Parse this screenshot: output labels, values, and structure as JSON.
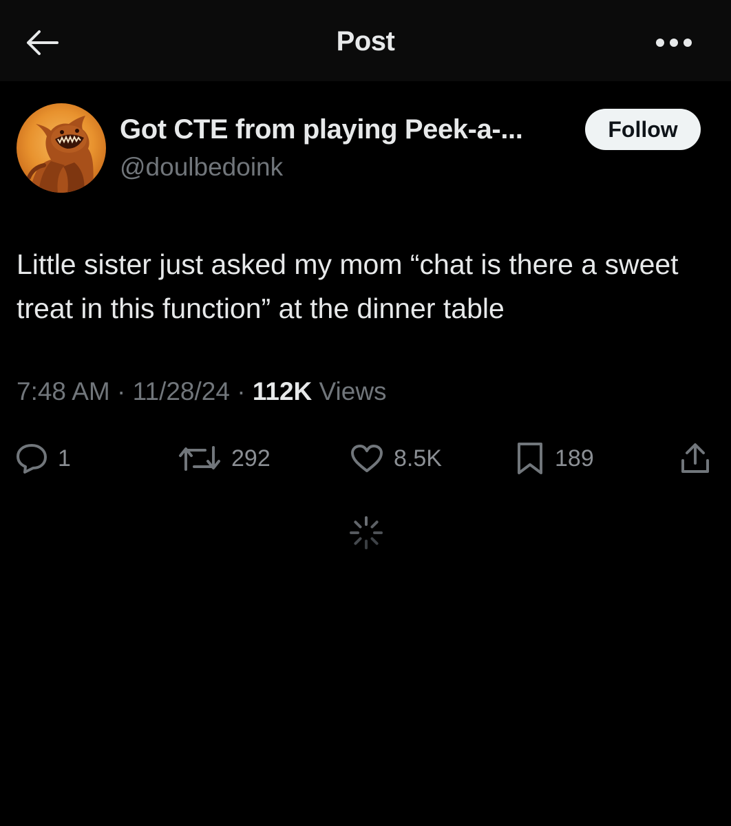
{
  "header": {
    "title": "Post",
    "back_icon": "arrow-left-icon",
    "more_icon": "more-horizontal-icon"
  },
  "author": {
    "display_name": "Got CTE from playing Peek-a-...",
    "handle": "@doulbedoink",
    "follow_label": "Follow"
  },
  "post": {
    "text": "Little sister just asked my mom “chat is there a sweet treat in this function” at the dinner table",
    "time": "7:48 AM",
    "date": "11/28/24",
    "views_count": "112K",
    "views_label": "Views",
    "separator": "·"
  },
  "actions": {
    "replies": "1",
    "reposts": "292",
    "likes": "8.5K",
    "bookmarks": "189"
  },
  "colors": {
    "background": "#000000",
    "header_background": "#0b0b0b",
    "primary_text": "#e7e9ea",
    "secondary_text": "#71767b",
    "follow_button": "#eff3f4"
  }
}
